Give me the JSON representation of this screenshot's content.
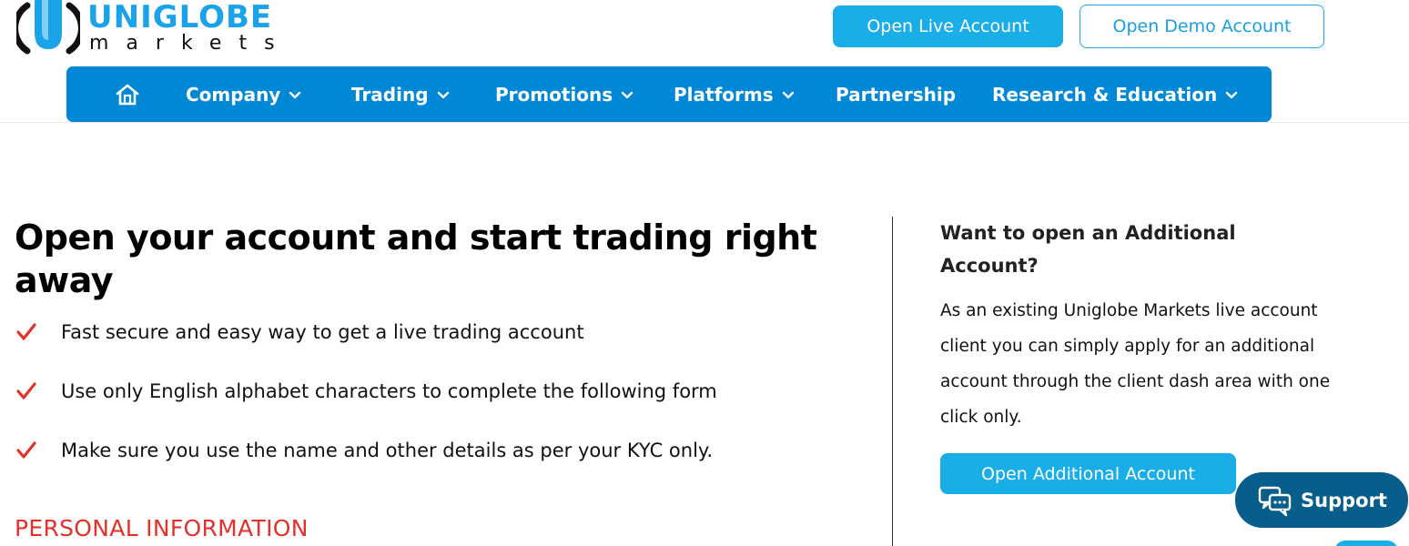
{
  "logo": {
    "top": "UNIGLOBE",
    "bottom": "markets"
  },
  "header": {
    "live_button": "Open Live Account",
    "demo_button": "Open Demo Account"
  },
  "nav": {
    "items": [
      {
        "label": "Company"
      },
      {
        "label": "Trading"
      },
      {
        "label": "Promotions"
      },
      {
        "label": "Platforms"
      },
      {
        "label": "Partnership"
      },
      {
        "label": "Research & Education"
      }
    ]
  },
  "main": {
    "title": "Open your account and start trading right away",
    "bullets": [
      "Fast secure and easy way to get a live trading account",
      "Use only English alphabet characters to complete the following form",
      "Make sure you use the name and other details as per your KYC only."
    ],
    "section_title": "PERSONAL INFORMATION"
  },
  "sidebar": {
    "title": "Want to open an Additional Account?",
    "text": "As an existing Uniglobe Markets live account client you can simply apply for an additional account through the client dash area with one click only.",
    "button": "Open Additional Account"
  },
  "support": {
    "label": "Support"
  },
  "colors": {
    "brand": "#1aaee8",
    "nav": "#0088d6",
    "accent_red": "#e2322b",
    "support": "#075e8c"
  },
  "icons": [
    "home-icon",
    "chevron-down-icon",
    "checkmark-icon",
    "chat-icon"
  ]
}
